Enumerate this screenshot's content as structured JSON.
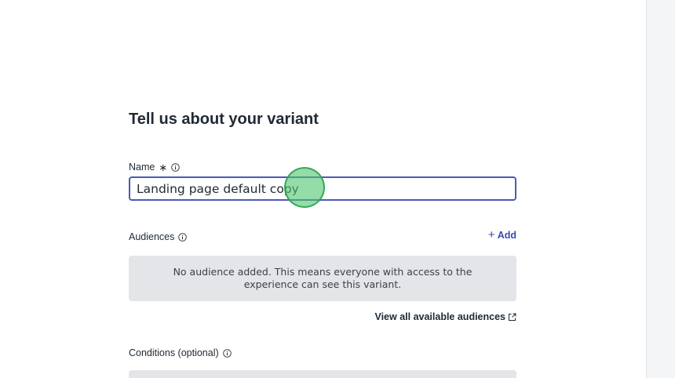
{
  "form": {
    "title": "Tell us about your variant",
    "name_label": "Name",
    "name_required_mark": "∗",
    "name_value": "Landing page default copy",
    "audiences_label": "Audiences",
    "add_plus": "+",
    "add_label": "Add",
    "audiences_empty_text": "No audience added. This means everyone with access to the experience can see this variant.",
    "view_all_label": "View all available audiences",
    "conditions_label": "Conditions (optional)"
  },
  "icons": {
    "info": "info-icon",
    "external_link": "external-link-icon"
  },
  "colors": {
    "accent": "#3b48b0",
    "input_border": "#4a5aba",
    "empty_box_bg": "#e3e5e8",
    "click_indicator": "#4cc46e"
  }
}
